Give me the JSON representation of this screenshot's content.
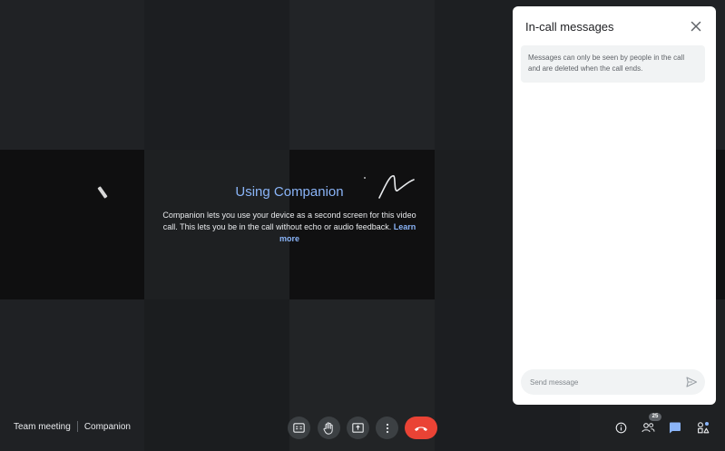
{
  "companion": {
    "title": "Using Companion",
    "description": "Companion lets you use your device as a second screen for this video call. This lets you be in the call without echo or audio feedback.",
    "learn_more": "Learn more"
  },
  "panel": {
    "title": "In-call messages",
    "notice": "Messages can only be seen by people in the call and are deleted when the call ends.",
    "input_placeholder": "Send message"
  },
  "meeting": {
    "name": "Team meeting",
    "mode": "Companion"
  },
  "controls": {
    "captions": "closed-captions-icon",
    "raise_hand": "raise-hand-icon",
    "present": "present-screen-icon",
    "more": "more-options-icon",
    "hangup": "hang-up-icon"
  },
  "right_controls": {
    "participants_count": "25"
  },
  "colors": {
    "accent": "#8ab4f8",
    "hangup": "#ea4335",
    "panel_bg": "#ffffff",
    "chat_active": "#8ab4f8"
  }
}
